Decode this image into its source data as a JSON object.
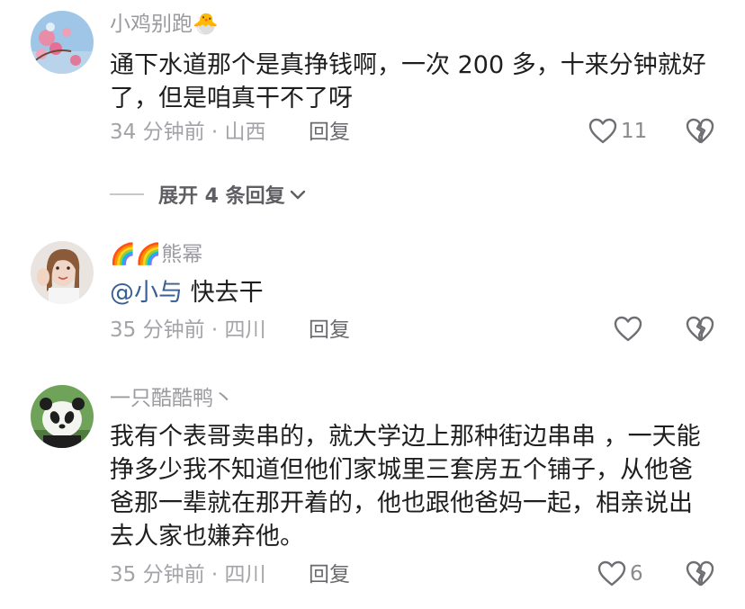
{
  "comments": [
    {
      "username": "小鸡别跑",
      "username_emoji": "🐣",
      "body": "通下水道那个是真挣钱啊，一次 200 多，十来分钟就好了，但是咱真干不了呀",
      "time": "34 分钟前",
      "location": "山西",
      "reply_label": "回复",
      "like_count": "11",
      "avatar": "flower-photo-avatar"
    },
    {
      "username_prefix": "🌈🌈",
      "username": "熊幂",
      "mention": "@小与",
      "body": " 快去干",
      "time": "35 分钟前",
      "location": "四川",
      "reply_label": "回复",
      "like_count": "",
      "avatar": "girl-photo-avatar"
    },
    {
      "username": "一只酷酷鸭丶",
      "body": "我有个表哥卖串的，就大学边上那种街边串串 ，一天能挣多少我不知道但他们家城里三套房五个铺子，从他爸爸那一辈就在那开着的，他也跟他爸妈一起，相亲说出去人家也嫌弃他。",
      "time": "35 分钟前",
      "location": "四川",
      "reply_label": "回复",
      "like_count": "6",
      "avatar": "panda-photo-avatar"
    }
  ],
  "expand_replies": {
    "label": "展开 4 条回复"
  },
  "meta_separator": "·",
  "icons": {
    "like": "heart-outline-icon",
    "dislike": "broken-heart-icon",
    "expand": "chevron-down-icon"
  },
  "colors": {
    "meta_gray": "#a3a3a8",
    "mention_blue": "#3a5f95"
  }
}
